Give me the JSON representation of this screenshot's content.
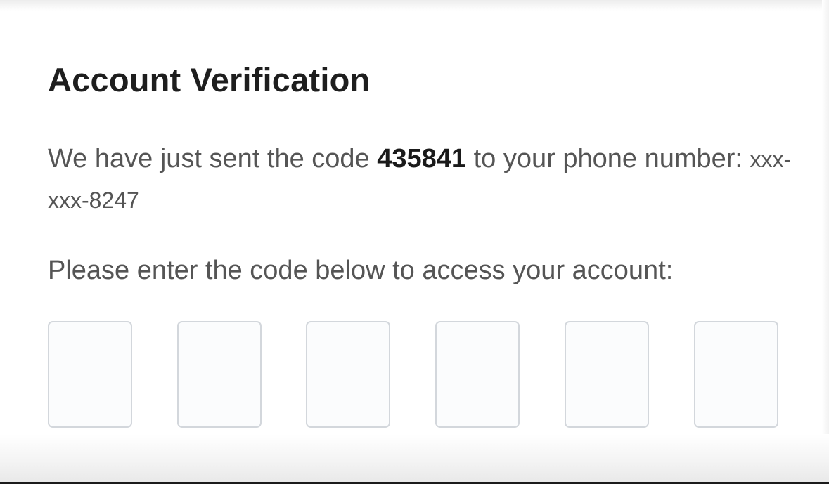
{
  "verification": {
    "title": "Account Verification",
    "message_prefix": "We have just sent the code ",
    "code": "435841",
    "message_suffix": " to your phone number: ",
    "phone_masked": "xxx-xxx-8247",
    "prompt": "Please enter the code below to access your account:",
    "code_inputs": [
      {
        "value": ""
      },
      {
        "value": ""
      },
      {
        "value": ""
      },
      {
        "value": ""
      },
      {
        "value": ""
      },
      {
        "value": ""
      }
    ]
  }
}
